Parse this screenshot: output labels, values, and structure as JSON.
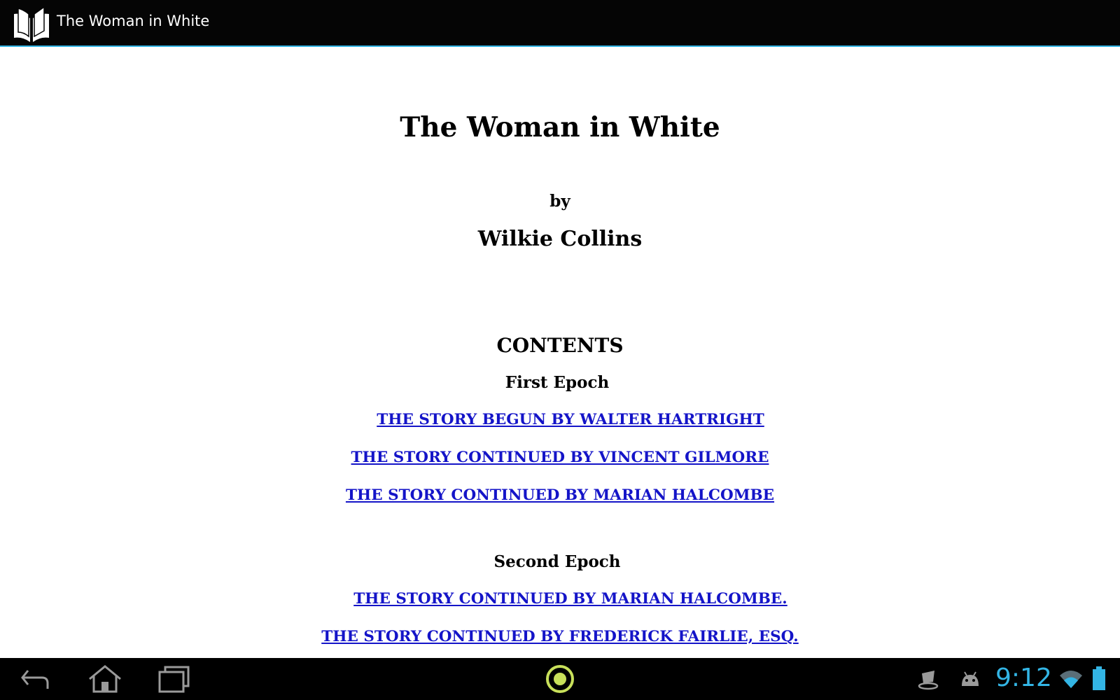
{
  "app_bar": {
    "title": "The Woman in White",
    "icon": "open-book-icon"
  },
  "book": {
    "title": "The Woman in White",
    "by": "by",
    "author": "Wilkie Collins",
    "contents_heading": "CONTENTS",
    "epochs": [
      {
        "label": "First Epoch",
        "links": [
          "THE STORY BEGUN BY WALTER HARTRIGHT",
          "THE STORY CONTINUED BY VINCENT GILMORE",
          "THE STORY CONTINUED BY MARIAN HALCOMBE"
        ]
      },
      {
        "label": "Second Epoch",
        "links": [
          "THE STORY CONTINUED BY MARIAN HALCOMBE.",
          "THE STORY CONTINUED BY FREDERICK FAIRLIE, ESQ."
        ]
      }
    ]
  },
  "system_bar": {
    "back_icon": "back-icon",
    "home_icon": "home-icon",
    "recents_icon": "recent-apps-icon",
    "center_icon": "ring-icon",
    "clock": "9:12",
    "status_icons": [
      "steam-icon",
      "android-debug-icon",
      "wifi-icon",
      "battery-icon"
    ],
    "accent_color": "#33b5e5"
  },
  "colors": {
    "link": "#1414c8",
    "bar_background": "#050505",
    "accent": "#33b5e5"
  }
}
